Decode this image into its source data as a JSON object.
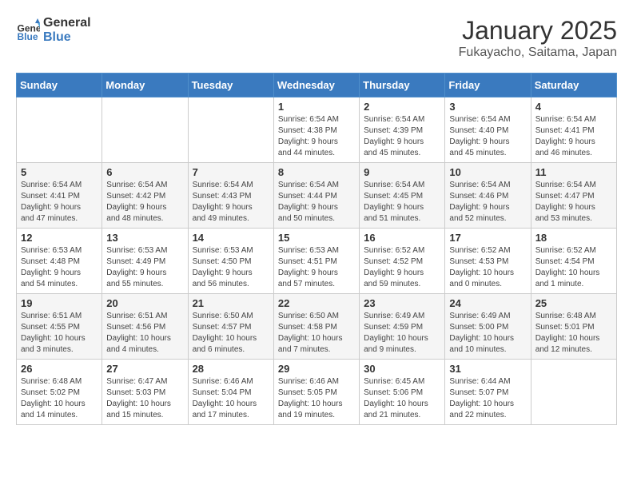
{
  "header": {
    "logo_line1": "General",
    "logo_line2": "Blue",
    "title": "January 2025",
    "subtitle": "Fukayacho, Saitama, Japan"
  },
  "weekdays": [
    "Sunday",
    "Monday",
    "Tuesday",
    "Wednesday",
    "Thursday",
    "Friday",
    "Saturday"
  ],
  "weeks": [
    [
      {
        "day": "",
        "info": ""
      },
      {
        "day": "",
        "info": ""
      },
      {
        "day": "",
        "info": ""
      },
      {
        "day": "1",
        "info": "Sunrise: 6:54 AM\nSunset: 4:38 PM\nDaylight: 9 hours\nand 44 minutes."
      },
      {
        "day": "2",
        "info": "Sunrise: 6:54 AM\nSunset: 4:39 PM\nDaylight: 9 hours\nand 45 minutes."
      },
      {
        "day": "3",
        "info": "Sunrise: 6:54 AM\nSunset: 4:40 PM\nDaylight: 9 hours\nand 45 minutes."
      },
      {
        "day": "4",
        "info": "Sunrise: 6:54 AM\nSunset: 4:41 PM\nDaylight: 9 hours\nand 46 minutes."
      }
    ],
    [
      {
        "day": "5",
        "info": "Sunrise: 6:54 AM\nSunset: 4:41 PM\nDaylight: 9 hours\nand 47 minutes."
      },
      {
        "day": "6",
        "info": "Sunrise: 6:54 AM\nSunset: 4:42 PM\nDaylight: 9 hours\nand 48 minutes."
      },
      {
        "day": "7",
        "info": "Sunrise: 6:54 AM\nSunset: 4:43 PM\nDaylight: 9 hours\nand 49 minutes."
      },
      {
        "day": "8",
        "info": "Sunrise: 6:54 AM\nSunset: 4:44 PM\nDaylight: 9 hours\nand 50 minutes."
      },
      {
        "day": "9",
        "info": "Sunrise: 6:54 AM\nSunset: 4:45 PM\nDaylight: 9 hours\nand 51 minutes."
      },
      {
        "day": "10",
        "info": "Sunrise: 6:54 AM\nSunset: 4:46 PM\nDaylight: 9 hours\nand 52 minutes."
      },
      {
        "day": "11",
        "info": "Sunrise: 6:54 AM\nSunset: 4:47 PM\nDaylight: 9 hours\nand 53 minutes."
      }
    ],
    [
      {
        "day": "12",
        "info": "Sunrise: 6:53 AM\nSunset: 4:48 PM\nDaylight: 9 hours\nand 54 minutes."
      },
      {
        "day": "13",
        "info": "Sunrise: 6:53 AM\nSunset: 4:49 PM\nDaylight: 9 hours\nand 55 minutes."
      },
      {
        "day": "14",
        "info": "Sunrise: 6:53 AM\nSunset: 4:50 PM\nDaylight: 9 hours\nand 56 minutes."
      },
      {
        "day": "15",
        "info": "Sunrise: 6:53 AM\nSunset: 4:51 PM\nDaylight: 9 hours\nand 57 minutes."
      },
      {
        "day": "16",
        "info": "Sunrise: 6:52 AM\nSunset: 4:52 PM\nDaylight: 9 hours\nand 59 minutes."
      },
      {
        "day": "17",
        "info": "Sunrise: 6:52 AM\nSunset: 4:53 PM\nDaylight: 10 hours\nand 0 minutes."
      },
      {
        "day": "18",
        "info": "Sunrise: 6:52 AM\nSunset: 4:54 PM\nDaylight: 10 hours\nand 1 minute."
      }
    ],
    [
      {
        "day": "19",
        "info": "Sunrise: 6:51 AM\nSunset: 4:55 PM\nDaylight: 10 hours\nand 3 minutes."
      },
      {
        "day": "20",
        "info": "Sunrise: 6:51 AM\nSunset: 4:56 PM\nDaylight: 10 hours\nand 4 minutes."
      },
      {
        "day": "21",
        "info": "Sunrise: 6:50 AM\nSunset: 4:57 PM\nDaylight: 10 hours\nand 6 minutes."
      },
      {
        "day": "22",
        "info": "Sunrise: 6:50 AM\nSunset: 4:58 PM\nDaylight: 10 hours\nand 7 minutes."
      },
      {
        "day": "23",
        "info": "Sunrise: 6:49 AM\nSunset: 4:59 PM\nDaylight: 10 hours\nand 9 minutes."
      },
      {
        "day": "24",
        "info": "Sunrise: 6:49 AM\nSunset: 5:00 PM\nDaylight: 10 hours\nand 10 minutes."
      },
      {
        "day": "25",
        "info": "Sunrise: 6:48 AM\nSunset: 5:01 PM\nDaylight: 10 hours\nand 12 minutes."
      }
    ],
    [
      {
        "day": "26",
        "info": "Sunrise: 6:48 AM\nSunset: 5:02 PM\nDaylight: 10 hours\nand 14 minutes."
      },
      {
        "day": "27",
        "info": "Sunrise: 6:47 AM\nSunset: 5:03 PM\nDaylight: 10 hours\nand 15 minutes."
      },
      {
        "day": "28",
        "info": "Sunrise: 6:46 AM\nSunset: 5:04 PM\nDaylight: 10 hours\nand 17 minutes."
      },
      {
        "day": "29",
        "info": "Sunrise: 6:46 AM\nSunset: 5:05 PM\nDaylight: 10 hours\nand 19 minutes."
      },
      {
        "day": "30",
        "info": "Sunrise: 6:45 AM\nSunset: 5:06 PM\nDaylight: 10 hours\nand 21 minutes."
      },
      {
        "day": "31",
        "info": "Sunrise: 6:44 AM\nSunset: 5:07 PM\nDaylight: 10 hours\nand 22 minutes."
      },
      {
        "day": "",
        "info": ""
      }
    ]
  ]
}
